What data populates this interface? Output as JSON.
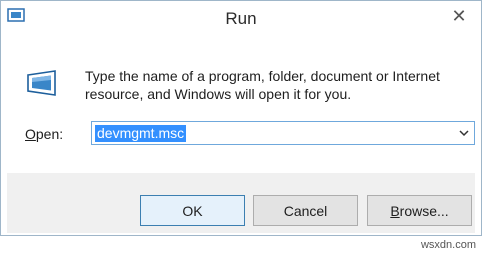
{
  "window": {
    "title": "Run",
    "close_symbol": "✕"
  },
  "dialog": {
    "description_line1": "Type the name of a program, folder, document or Internet",
    "description_line2": "resource, and Windows will open it for you.",
    "open_label_prefix": "O",
    "open_label_rest": "pen:",
    "open_value": "devmgmt.msc"
  },
  "buttons": {
    "ok": "OK",
    "cancel": "Cancel",
    "browse_prefix": "B",
    "browse_rest": "rowse..."
  },
  "watermark": "wsxdn.com",
  "colors": {
    "selection": "#3390ff",
    "accent_border": "#6fa8dc"
  }
}
